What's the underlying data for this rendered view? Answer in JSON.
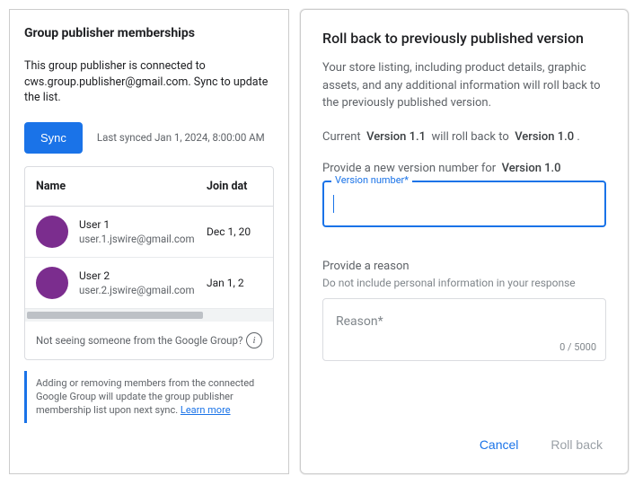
{
  "left": {
    "title": "Group publisher memberships",
    "description": "This group publisher is connected to cws.group.publisher@gmail.com. Sync to update the list.",
    "sync_label": "Sync",
    "last_synced": "Last synced Jan 1, 2024, 8:00:00 AM",
    "columns": {
      "name": "Name",
      "join": "Join dat"
    },
    "rows": [
      {
        "name": "User 1",
        "email": "user.1.jswire@gmail.com",
        "join": "Dec 1, 20"
      },
      {
        "name": "User 2",
        "email": "user.2.jswire@gmail.com",
        "join": "Jan 1, 2"
      }
    ],
    "not_seeing": "Not seeing someone from the Google Group?",
    "note_text": "Adding or removing members from the connected Google Group will update the group publisher membership list upon next sync. ",
    "learn_more": "Learn more"
  },
  "right": {
    "title": "Roll back to previously published version",
    "description": "Your store listing, including product details, graphic assets, and any additional information will roll back to the previously published version.",
    "current_prefix": "Current",
    "current_version": "Version 1.1",
    "will_roll_back_to": "will roll back to",
    "target_version": "Version 1.0",
    "period": ".",
    "provide_version_prefix": "Provide a new version number for",
    "provide_version_target": "Version 1.0",
    "version_field_label": "Version number*",
    "version_field_value": "",
    "reason_title": "Provide a reason",
    "reason_sub": "Do not include personal information in your response",
    "reason_placeholder": "Reason*",
    "reason_count": "0 / 5000",
    "cancel": "Cancel",
    "rollback": "Roll back"
  }
}
